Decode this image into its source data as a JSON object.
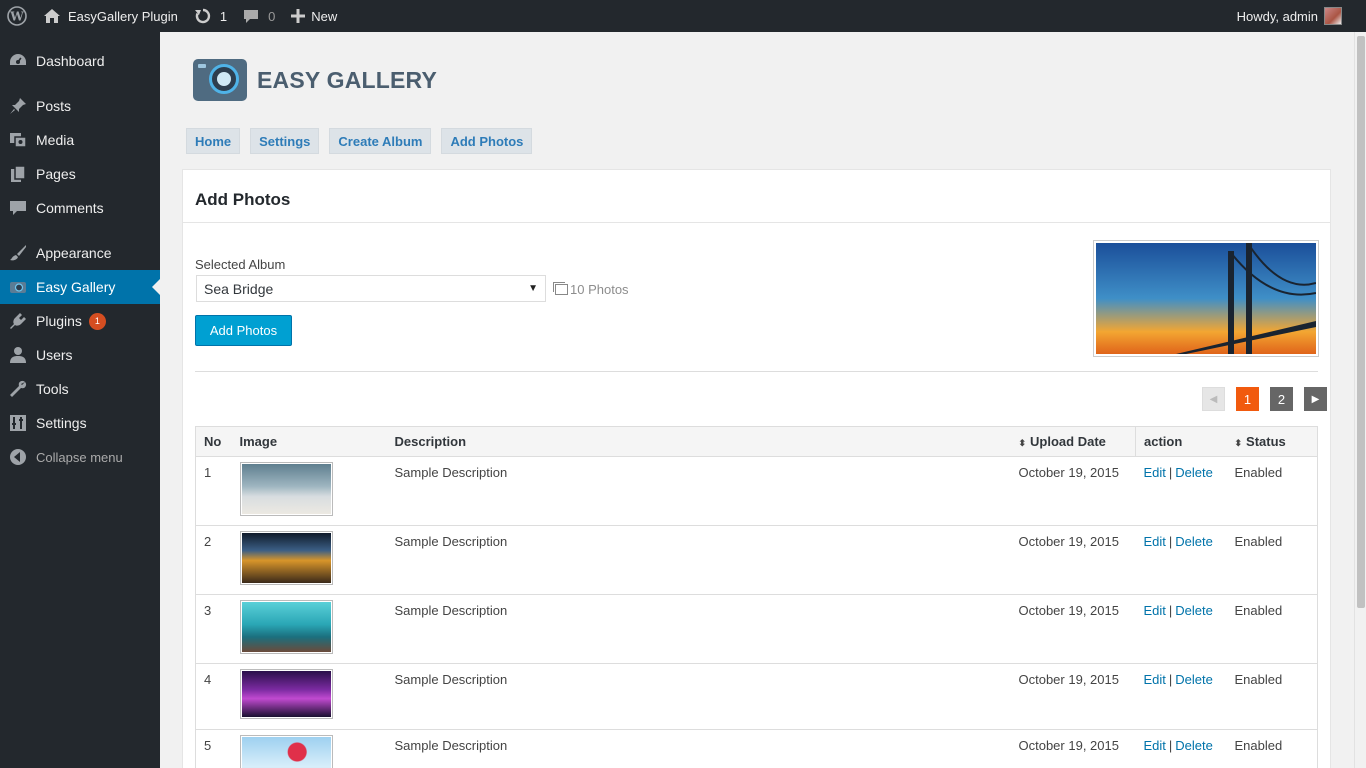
{
  "adminbar": {
    "site_name": "EasyGallery Plugin",
    "updates_count": "1",
    "comments_count": "0",
    "new_label": "New",
    "howdy": "Howdy, admin"
  },
  "sidebar": {
    "items": [
      {
        "label": "Dashboard",
        "icon": "dashboard-icon"
      },
      {
        "label": "Posts",
        "icon": "pin-icon"
      },
      {
        "label": "Media",
        "icon": "media-icon"
      },
      {
        "label": "Pages",
        "icon": "pages-icon"
      },
      {
        "label": "Comments",
        "icon": "comment-icon"
      },
      {
        "label": "Appearance",
        "icon": "brush-icon"
      },
      {
        "label": "Easy Gallery",
        "icon": "camera-icon"
      },
      {
        "label": "Plugins",
        "icon": "plugin-icon",
        "badge": "1"
      },
      {
        "label": "Users",
        "icon": "user-icon"
      },
      {
        "label": "Tools",
        "icon": "wrench-icon"
      },
      {
        "label": "Settings",
        "icon": "settings-icon"
      }
    ],
    "collapse_label": "Collapse menu"
  },
  "plugin": {
    "title": "EASY GALLERY",
    "nav": [
      "Home",
      "Settings",
      "Create Album",
      "Add Photos"
    ]
  },
  "panel": {
    "title": "Add Photos",
    "album_label": "Selected Album",
    "album_value": "Sea Bridge",
    "photo_count": "10 Photos",
    "add_button": "Add Photos"
  },
  "pager": {
    "prev": "◀",
    "pages": [
      "1",
      "2"
    ],
    "current": "1",
    "next": "▶"
  },
  "table": {
    "headers": {
      "no": "No",
      "image": "Image",
      "description": "Description",
      "upload_date": "Upload Date",
      "action": "action",
      "status": "Status"
    },
    "edit_label": "Edit",
    "delete_label": "Delete",
    "rows": [
      {
        "no": "1",
        "description": "Sample Description",
        "date": "October 19, 2015",
        "status": "Enabled"
      },
      {
        "no": "2",
        "description": "Sample Description",
        "date": "October 19, 2015",
        "status": "Enabled"
      },
      {
        "no": "3",
        "description": "Sample Description",
        "date": "October 19, 2015",
        "status": "Enabled"
      },
      {
        "no": "4",
        "description": "Sample Description",
        "date": "October 19, 2015",
        "status": "Enabled"
      },
      {
        "no": "5",
        "description": "Sample Description",
        "date": "October 19, 2015",
        "status": "Enabled"
      }
    ]
  },
  "colors": {
    "adminbar": "#23282d",
    "accent": "#0073aa",
    "button": "#00a0d2",
    "page_current": "#f15a0e",
    "status_enabled": "#2aa52a"
  }
}
